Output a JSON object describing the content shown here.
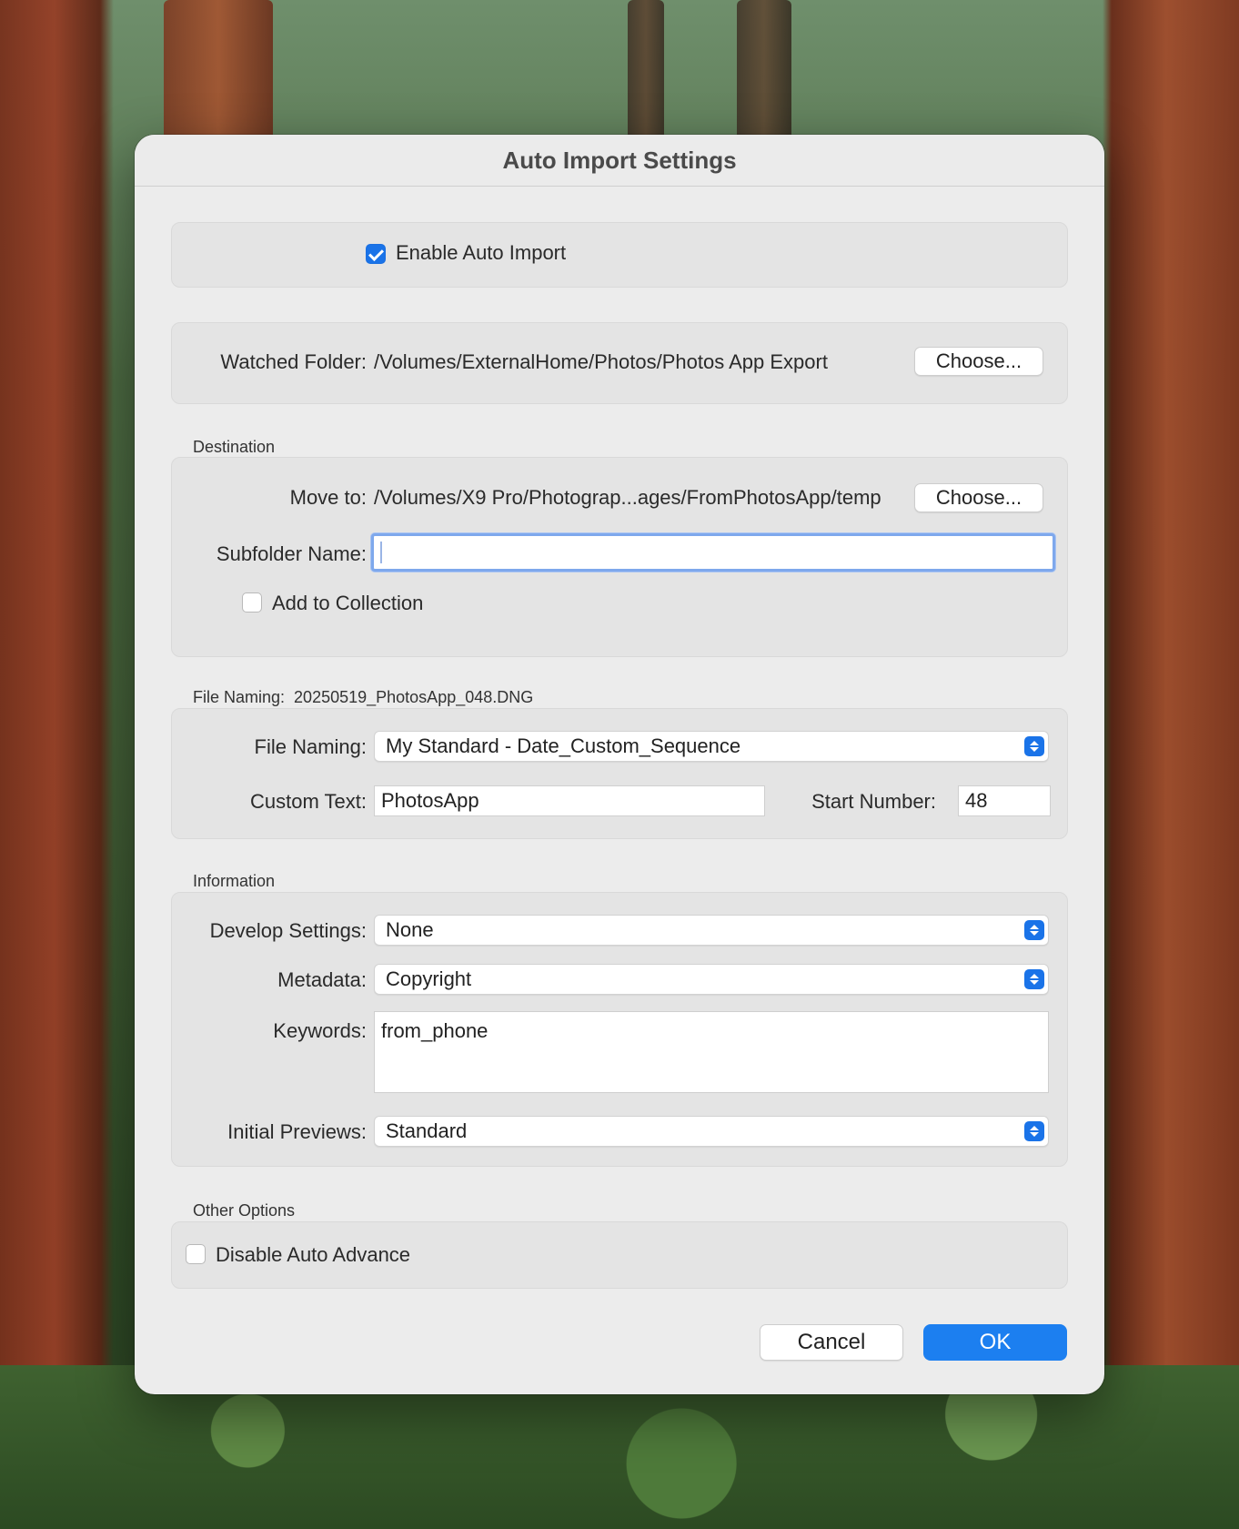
{
  "dialog": {
    "title": "Auto Import Settings"
  },
  "enable": {
    "label": "Enable Auto Import",
    "checked": true
  },
  "watched": {
    "label": "Watched Folder:",
    "path": "/Volumes/ExternalHome/Photos/Photos App Export",
    "button": "Choose..."
  },
  "destination": {
    "section": "Destination",
    "move_label": "Move to:",
    "move_path": "/Volumes/X9 Pro/Photograp...ages/FromPhotosApp/temp",
    "button": "Choose...",
    "subfolder_label": "Subfolder Name:",
    "subfolder_value": "",
    "collection_label": "Add to Collection",
    "collection_checked": false
  },
  "file_naming": {
    "section_label": "File Naming:",
    "preview": "20250519_PhotosApp_048.DNG",
    "naming_label": "File Naming:",
    "naming_value": "My Standard - Date_Custom_Sequence",
    "custom_label": "Custom Text:",
    "custom_value": "PhotosApp",
    "start_label": "Start Number:",
    "start_value": "48"
  },
  "information": {
    "section": "Information",
    "develop_label": "Develop Settings:",
    "develop_value": "None",
    "metadata_label": "Metadata:",
    "metadata_value": "Copyright",
    "keywords_label": "Keywords:",
    "keywords_value": "from_phone",
    "previews_label": "Initial Previews:",
    "previews_value": "Standard"
  },
  "other": {
    "section": "Other Options",
    "auto_advance_label": "Disable Auto Advance",
    "auto_advance_checked": false
  },
  "buttons": {
    "cancel": "Cancel",
    "ok": "OK"
  },
  "colors": {
    "accent": "#1c7ff0",
    "dialog_bg": "#ececec"
  },
  "icons": {
    "select_stepper": "up-down-chevron-icon",
    "checkmark": "checkmark-icon"
  }
}
